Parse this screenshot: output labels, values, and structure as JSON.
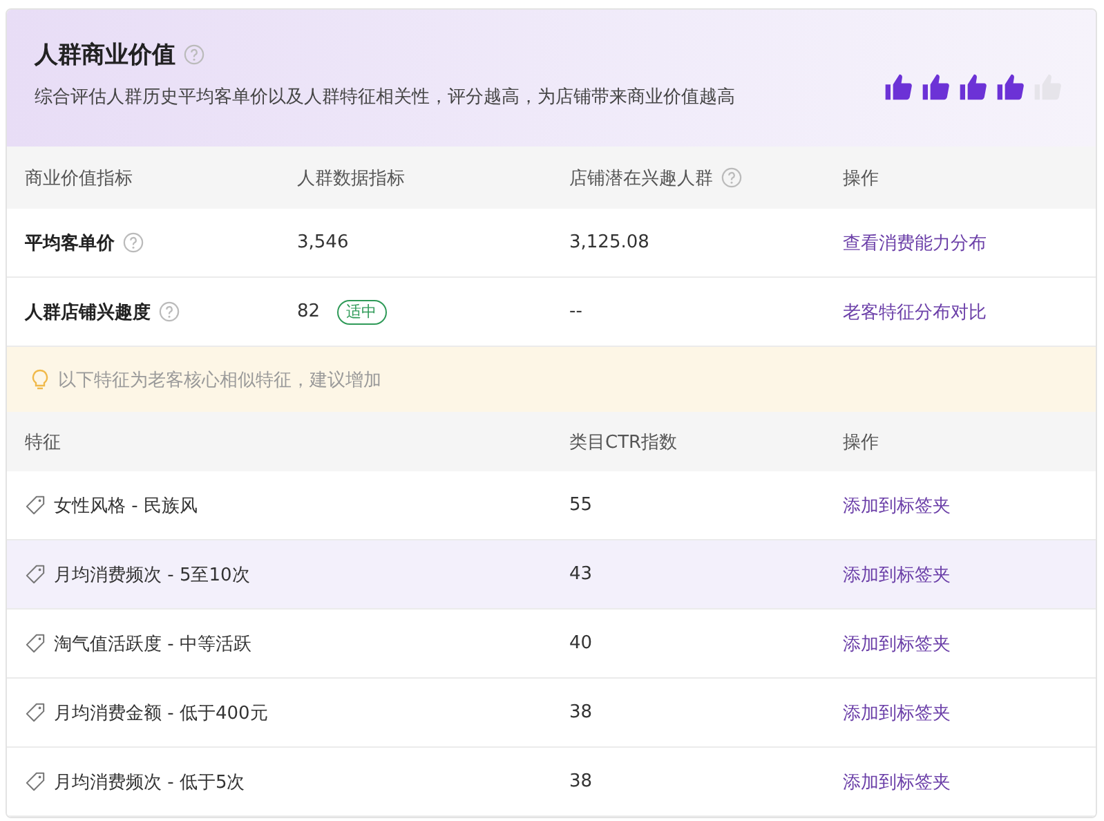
{
  "header": {
    "title": "人群商业价值",
    "description": "综合评估人群历史平均客单价以及人群特征相关性，评分越高，为店铺带来商业价值越高",
    "rating": {
      "stars": 4
    }
  },
  "metrics_table": {
    "columns": [
      {
        "label": "商业价值指标",
        "help": false
      },
      {
        "label": "人群数据指标",
        "help": false
      },
      {
        "label": "店铺潜在兴趣人群",
        "help": true
      },
      {
        "label": "操作",
        "help": false
      }
    ],
    "rows": [
      {
        "name": "平均客单价",
        "data": "3,546",
        "badge": null,
        "potential": "3,125.08",
        "action": "查看消费能力分布"
      },
      {
        "name": "人群店铺兴趣度",
        "data": "82",
        "badge": "适中",
        "potential": "--",
        "action": "老客特征分布对比"
      }
    ]
  },
  "notice": "以下特征为老客核心相似特征，建议增加",
  "features_table": {
    "columns": [
      "特征",
      "类目CTR指数",
      "操作"
    ],
    "rows": [
      {
        "feature": "女性风格 - 民族风",
        "ctr": "55",
        "action": "添加到标签夹",
        "hovered": false
      },
      {
        "feature": "月均消费频次 - 5至10次",
        "ctr": "43",
        "action": "添加到标签夹",
        "hovered": true
      },
      {
        "feature": "淘气值活跃度 - 中等活跃",
        "ctr": "40",
        "action": "添加到标签夹",
        "hovered": false
      },
      {
        "feature": "月均消费金额 - 低于400元",
        "ctr": "38",
        "action": "添加到标签夹",
        "hovered": false
      },
      {
        "feature": "月均消费频次 - 低于5次",
        "ctr": "38",
        "action": "添加到标签夹",
        "hovered": false
      }
    ]
  }
}
